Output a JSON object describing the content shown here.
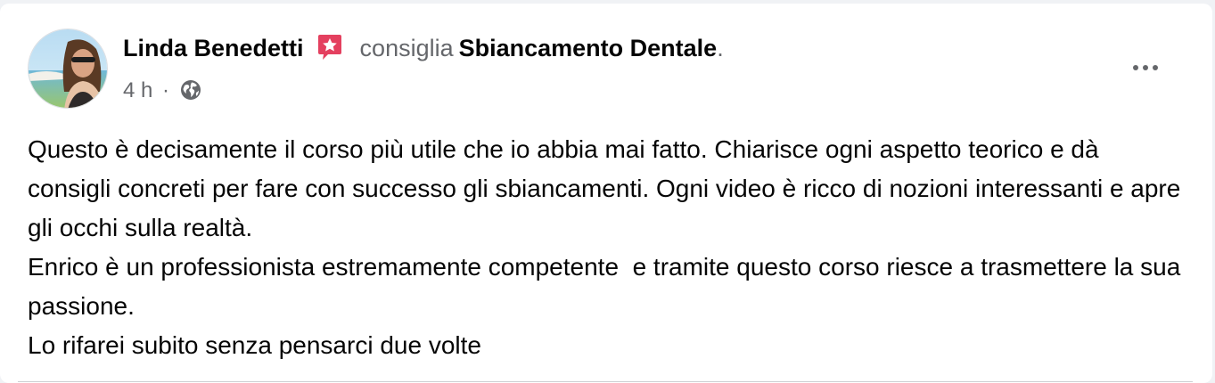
{
  "post": {
    "author": "Linda Benedetti",
    "verb": "consiglia",
    "page": "Sbiancamento Dentale",
    "period": ".",
    "time": "4 h",
    "separator": "·",
    "audience_icon": "globe-icon",
    "badge_icon": "recommend-star-icon",
    "more_icon": "more-options-icon",
    "body_lines": [
      "Questo è decisamente il corso più utile che io abbia mai fatto. Chiarisce ogni aspetto teorico e dà consigli concreti per fare con successo gli sbiancamenti. Ogni video è ricco di nozioni interessanti e apre gli occhi sulla realtà.",
      "Enrico è un professionista estremamente competente  e tramite questo corso riesce a trasmettere la sua passione.",
      "Lo rifarei subito senza pensarci due volte"
    ]
  },
  "colors": {
    "badge": "#e4405f",
    "text_primary": "#050505",
    "text_secondary": "#65676b",
    "background": "#f0f2f5"
  }
}
